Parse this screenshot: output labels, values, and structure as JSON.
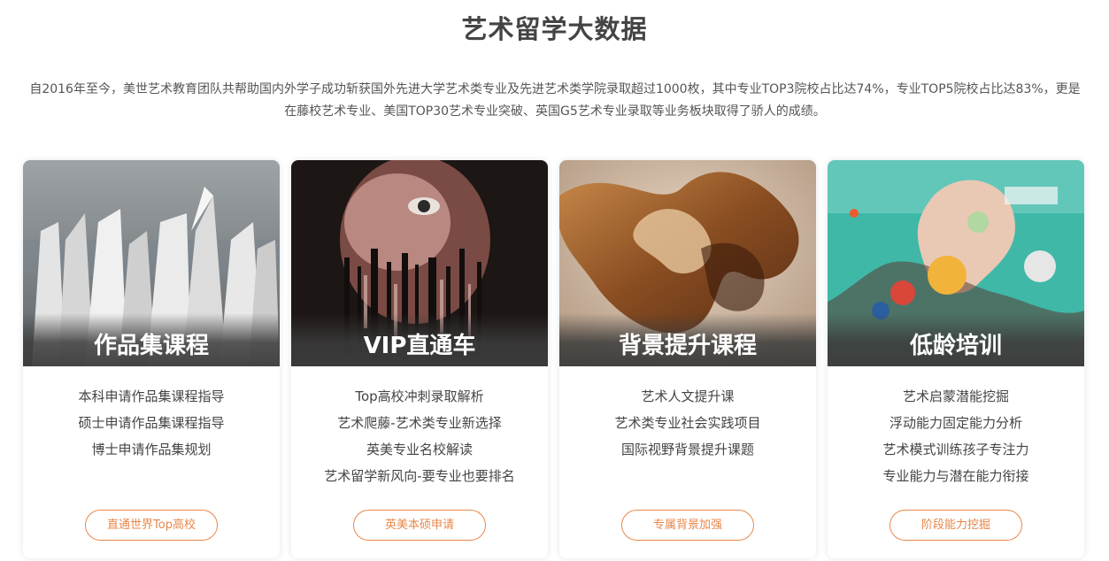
{
  "section": {
    "title": "艺术留学大数据",
    "intro": "自2016年至今，美世艺术教育团队共帮助国内外学子成功斩获国外先进大学艺术类专业及先进艺术类学院录取超过1000枚，其中专业TOP3院校占比达74%，专业TOP5院校占比达83%，更是在藤校艺术专业、美国TOP30艺术专业突破、英国G5艺术专业录取等业务板块取得了骄人的成绩。"
  },
  "cards": [
    {
      "title": "作品集课程",
      "items": [
        "本科申请作品集课程指导",
        "硕士申请作品集课程指导",
        "博士申请作品集规划",
        ""
      ],
      "button": "直通世界Top高校"
    },
    {
      "title": "VIP直通车",
      "items": [
        "Top高校冲刺录取解析",
        "艺术爬藤-艺术类专业新选择",
        "英美专业名校解读",
        "艺术留学新风向-要专业也要排名"
      ],
      "button": "英美本硕申请"
    },
    {
      "title": "背景提升课程",
      "items": [
        "艺术人文提升课",
        "艺术类专业社会实践项目",
        "国际视野背景提升课题",
        ""
      ],
      "button": "专属背景加强"
    },
    {
      "title": "低龄培训",
      "items": [
        "艺术启蒙潜能挖掘",
        "浮动能力固定能力分析",
        "艺术模式训练孩子专注力",
        "专业能力与潜在能力衔接"
      ],
      "button": "阶段能力挖掘"
    }
  ],
  "colors": {
    "accent": "#e8874a",
    "title": "#444444",
    "text": "#555555"
  }
}
